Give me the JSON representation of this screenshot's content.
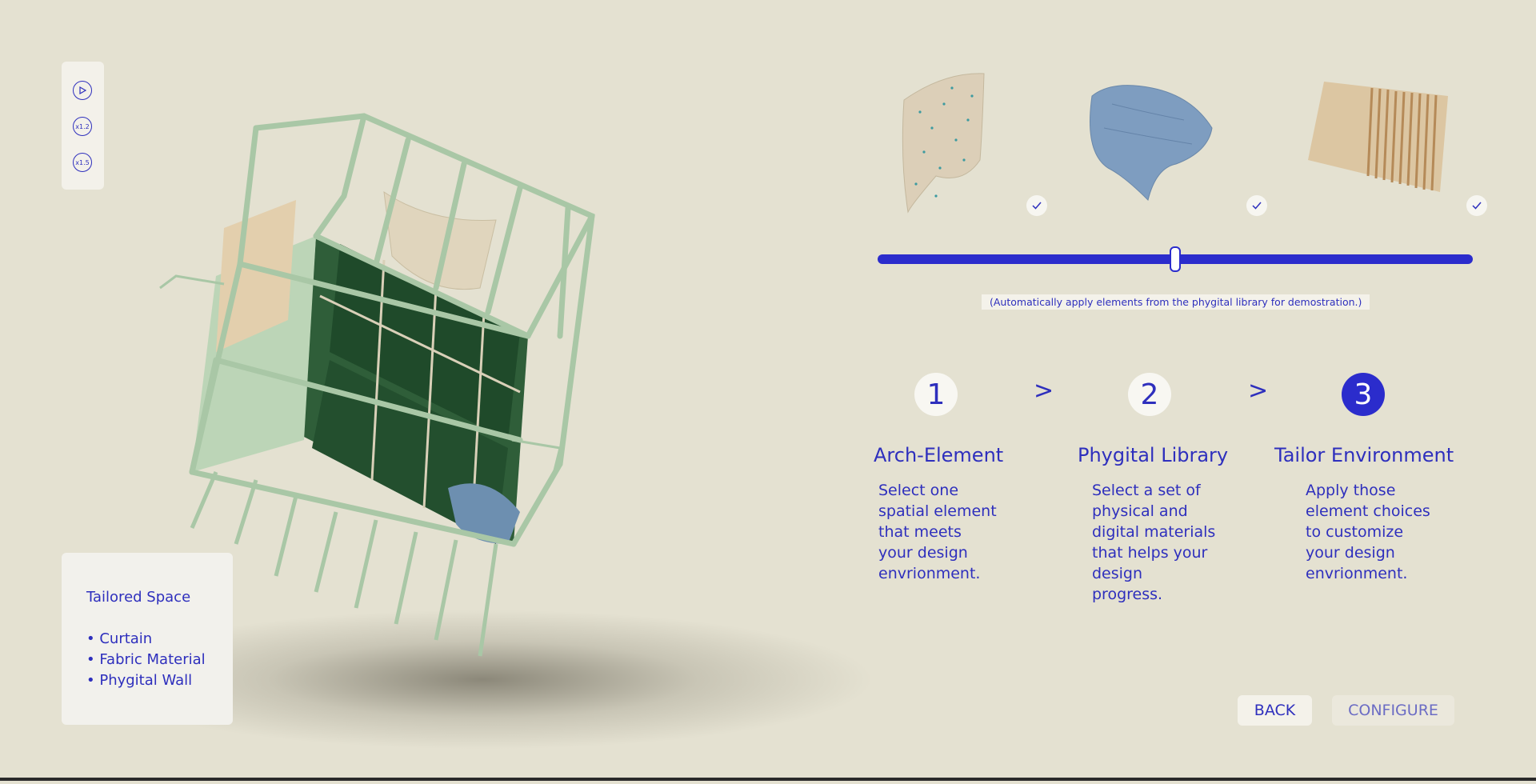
{
  "controls": [
    {
      "icon": "play-icon",
      "label": ""
    },
    {
      "icon": "speed-icon",
      "label": "x1.2"
    },
    {
      "icon": "speed-icon",
      "label": "x1.5"
    }
  ],
  "info_card": {
    "title": "Tailored Space",
    "items": [
      "• Curtain",
      "• Fabric Material",
      "• Phygital Wall"
    ]
  },
  "materials": [
    {
      "name": "speckled-fabric",
      "checked": true
    },
    {
      "name": "blue-fabric",
      "checked": true
    },
    {
      "name": "wood-panel",
      "checked": true
    }
  ],
  "slider": {
    "value_fraction": 0.5
  },
  "note": "(Automatically apply elements from the phygital library for demostration.)",
  "steps": [
    {
      "number": "1",
      "title": "Arch-Element",
      "desc": "Select one spatial element that meets your design envrionment.",
      "active": false
    },
    {
      "number": "2",
      "title": "Phygital Library",
      "desc": "Select a set of physical and digital materials that helps your design progress.",
      "active": false
    },
    {
      "number": "3",
      "title": "Tailor Environment",
      "desc": "Apply those element choices to customize your design envrionment.",
      "active": true
    }
  ],
  "separator": ">",
  "buttons": {
    "back": "BACK",
    "configure": "CONFIGURE"
  },
  "colors": {
    "accent": "#2b2ccc",
    "background": "#e4e1d1",
    "frame": "#a9c7a6",
    "panel": "#f2f1ec"
  }
}
